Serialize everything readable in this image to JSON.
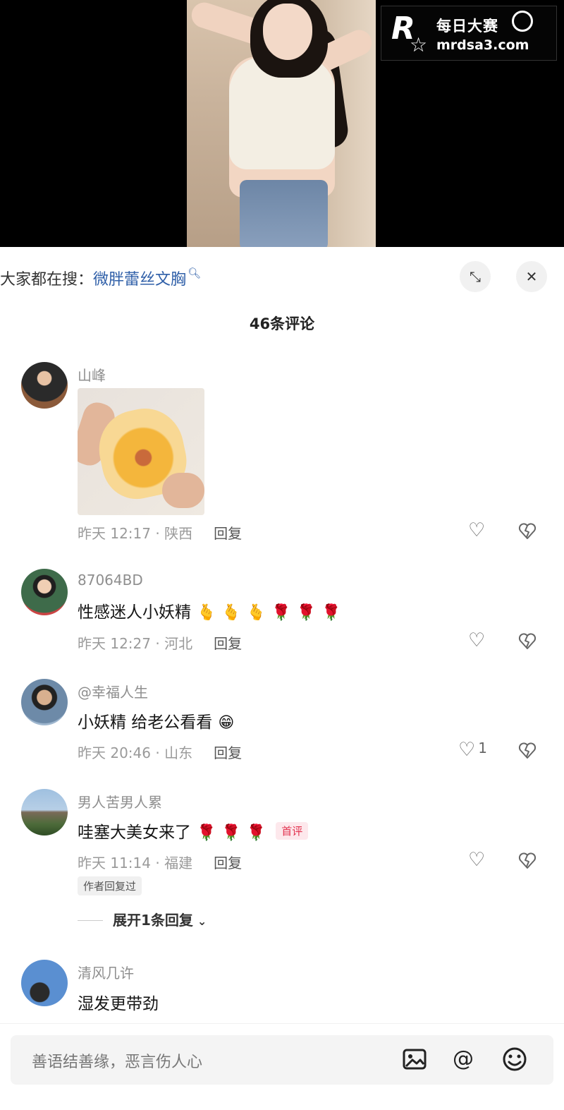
{
  "watermark": {
    "logo_letter": "R",
    "site_name": "每日大赛",
    "site_url": "mrdsa3.com"
  },
  "search": {
    "prefix": "大家都在搜：",
    "query": "微胖蕾丝文胸",
    "search_glyph": "magnifier-icon",
    "collapse_glyph": "collapse-icon",
    "close_glyph": "close-icon"
  },
  "comments_header": {
    "count_label": "46条评论"
  },
  "comments": [
    {
      "username": "山峰",
      "text": "",
      "time_location": "昨天 12:17 · 陕西",
      "reply_label": "回复",
      "likes": ""
    },
    {
      "username": "87064BD",
      "text": "性感迷人小妖精",
      "emojis": [
        "🫰",
        "🫰",
        "🫰",
        "🌹",
        "🌹",
        "🌹"
      ],
      "time_location": "昨天 12:27 · 河北",
      "reply_label": "回复",
      "likes": ""
    },
    {
      "username": "@幸福人生",
      "text": "小妖精 给老公看看",
      "emojis": [
        "😁"
      ],
      "time_location": "昨天 20:46 · 山东",
      "reply_label": "回复",
      "likes": "1"
    },
    {
      "username": "男人苦男人累",
      "text": "哇塞大美女来了",
      "emojis": [
        "🌹",
        "🌹",
        "🌹"
      ],
      "badge": "首评",
      "time_location": "昨天 11:14 · 福建",
      "reply_label": "回复",
      "author_tag": "作者回复过",
      "expand_label": "展开1条回复",
      "likes": ""
    },
    {
      "username": "清风几许",
      "text": "湿发更带劲"
    }
  ],
  "composer": {
    "placeholder": "善语结善缘，恶言伤人心",
    "icons": [
      "image-icon",
      "at-icon",
      "emoji-icon"
    ]
  }
}
